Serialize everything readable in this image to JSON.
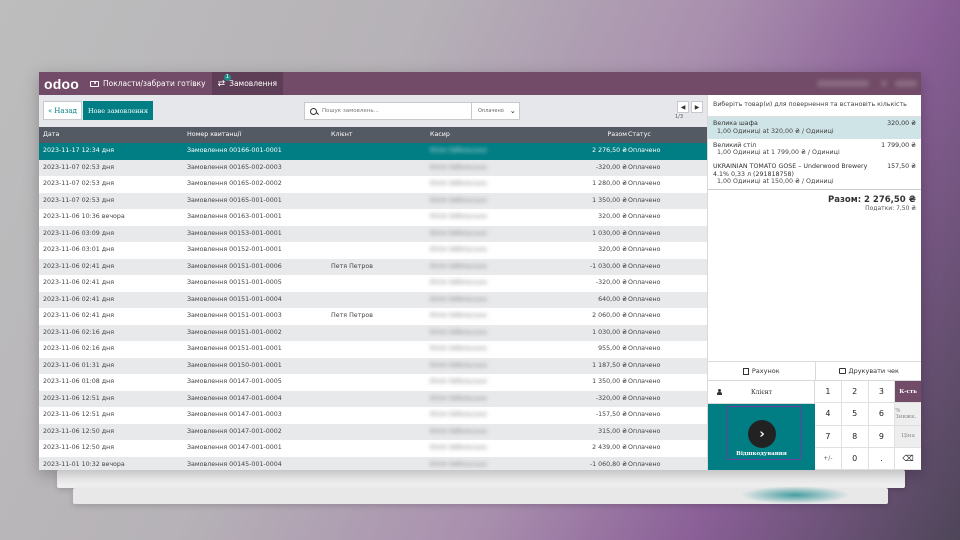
{
  "navbar": {
    "logo": "odoo",
    "cash_label": "Покласти/забрати готівку",
    "orders_label": "Замовлення",
    "orders_badge": "1"
  },
  "controls": {
    "back_label": "Назад",
    "new_order_label": "Нове замовлення",
    "search_placeholder": "Пошук замовлень...",
    "filter_value": "Оплачено",
    "pager_label": "1/3"
  },
  "table": {
    "headers": {
      "date": "Дата",
      "receipt": "Номер квитанції",
      "client": "Клієнт",
      "cashier": "Касир",
      "total": "Разом",
      "status": "Статус"
    },
    "rows": [
      {
        "date": "2023-11-17 12:34 дня",
        "receipt": "Замовлення 00166-001-0001",
        "client": "",
        "cashier": "Юлія Забельська",
        "total": "2 276,50 ₴",
        "status": "Оплачено"
      },
      {
        "date": "2023-11-07 02:53 дня",
        "receipt": "Замовлення 00165-002-0003",
        "client": "",
        "cashier": "Юлія Забельська",
        "total": "-320,00 ₴",
        "status": "Оплачено"
      },
      {
        "date": "2023-11-07 02:53 дня",
        "receipt": "Замовлення 00165-002-0002",
        "client": "",
        "cashier": "Юлія Забельська",
        "total": "1 280,00 ₴",
        "status": "Оплачено"
      },
      {
        "date": "2023-11-07 02:53 дня",
        "receipt": "Замовлення 00165-001-0001",
        "client": "",
        "cashier": "Юлія Забельська",
        "total": "1 350,00 ₴",
        "status": "Оплачено"
      },
      {
        "date": "2023-11-06 10:36 вечора",
        "receipt": "Замовлення 00163-001-0001",
        "client": "",
        "cashier": "Юлія Забельська",
        "total": "320,00 ₴",
        "status": "Оплачено"
      },
      {
        "date": "2023-11-06 03:09 дня",
        "receipt": "Замовлення 00153-001-0001",
        "client": "",
        "cashier": "Юлія Забельська",
        "total": "1 030,00 ₴",
        "status": "Оплачено"
      },
      {
        "date": "2023-11-06 03:01 дня",
        "receipt": "Замовлення 00152-001-0001",
        "client": "",
        "cashier": "Юлія Забельська",
        "total": "320,00 ₴",
        "status": "Оплачено"
      },
      {
        "date": "2023-11-06 02:41 дня",
        "receipt": "Замовлення 00151-001-0006",
        "client": "Петя Петров",
        "cashier": "Юлія Забельська",
        "total": "-1 030,00 ₴",
        "status": "Оплачено"
      },
      {
        "date": "2023-11-06 02:41 дня",
        "receipt": "Замовлення 00151-001-0005",
        "client": "",
        "cashier": "Юлія Забельська",
        "total": "-320,00 ₴",
        "status": "Оплачено"
      },
      {
        "date": "2023-11-06 02:41 дня",
        "receipt": "Замовлення 00151-001-0004",
        "client": "",
        "cashier": "Юлія Забельська",
        "total": "640,00 ₴",
        "status": "Оплачено"
      },
      {
        "date": "2023-11-06 02:41 дня",
        "receipt": "Замовлення 00151-001-0003",
        "client": "Петя Петров",
        "cashier": "Юлія Забельська",
        "total": "2 060,00 ₴",
        "status": "Оплачено"
      },
      {
        "date": "2023-11-06 02:16 дня",
        "receipt": "Замовлення 00151-001-0002",
        "client": "",
        "cashier": "Юлія Забельська",
        "total": "1 030,00 ₴",
        "status": "Оплачено"
      },
      {
        "date": "2023-11-06 02:16 дня",
        "receipt": "Замовлення 00151-001-0001",
        "client": "",
        "cashier": "Юлія Забельська",
        "total": "955,00 ₴",
        "status": "Оплачено"
      },
      {
        "date": "2023-11-06 01:31 дня",
        "receipt": "Замовлення 00150-001-0001",
        "client": "",
        "cashier": "Юлія Забельська",
        "total": "1 187,50 ₴",
        "status": "Оплачено"
      },
      {
        "date": "2023-11-06 01:08 дня",
        "receipt": "Замовлення 00147-001-0005",
        "client": "",
        "cashier": "Юлія Забельська",
        "total": "1 350,00 ₴",
        "status": "Оплачено"
      },
      {
        "date": "2023-11-06 12:51 дня",
        "receipt": "Замовлення 00147-001-0004",
        "client": "",
        "cashier": "Юлія Забельська",
        "total": "-320,00 ₴",
        "status": "Оплачено"
      },
      {
        "date": "2023-11-06 12:51 дня",
        "receipt": "Замовлення 00147-001-0003",
        "client": "",
        "cashier": "Юлія Забельська",
        "total": "-157,50 ₴",
        "status": "Оплачено"
      },
      {
        "date": "2023-11-06 12:50 дня",
        "receipt": "Замовлення 00147-001-0002",
        "client": "",
        "cashier": "Юлія Забельська",
        "total": "315,00 ₴",
        "status": "Оплачено"
      },
      {
        "date": "2023-11-06 12:50 дня",
        "receipt": "Замовлення 00147-001-0001",
        "client": "",
        "cashier": "Юлія Забельська",
        "total": "2 439,00 ₴",
        "status": "Оплачено"
      },
      {
        "date": "2023-11-01 10:32 вечора",
        "receipt": "Замовлення 00145-001-0004",
        "client": "",
        "cashier": "Юлія Забельська",
        "total": "-1 060,80 ₴",
        "status": "Оплачено"
      }
    ]
  },
  "order_panel": {
    "instruction": "Виберіть товар(и) для повернення та встановіть кількість",
    "lines": [
      {
        "name": "Велика шафа",
        "price": "320,00 ₴",
        "detail": "1,00 Одиниці at 320,00 ₴ / Одиниці"
      },
      {
        "name": "Великий стіл",
        "price": "1 799,00 ₴",
        "detail": "1,00 Одиниці at 1 799,00 ₴ / Одиниці"
      },
      {
        "name": "UKRAINIAN TOMATO GOSE – Underwood Brewery 4.1% 0,33 л (291818758)",
        "price": "157,50 ₴",
        "detail": "1,00 Одиниці at 150,00 ₴ / Одиниці"
      }
    ],
    "total": "Разом: 2 276,50 ₴",
    "taxes": "Податки: 7,50 ₴",
    "invoice_label": "Рахунок",
    "print_label": "Друкувати чек",
    "client_label": "Клієнт",
    "payment_label": "Відшкодування",
    "numpad": [
      "1",
      "2",
      "3",
      "К-сть",
      "4",
      "5",
      "6",
      "% Знижк.",
      "7",
      "8",
      "9",
      "Ціна",
      "+/-",
      "0",
      ".",
      "⌫"
    ]
  },
  "colors": {
    "brand": "#714b67",
    "accent": "#017e84"
  }
}
